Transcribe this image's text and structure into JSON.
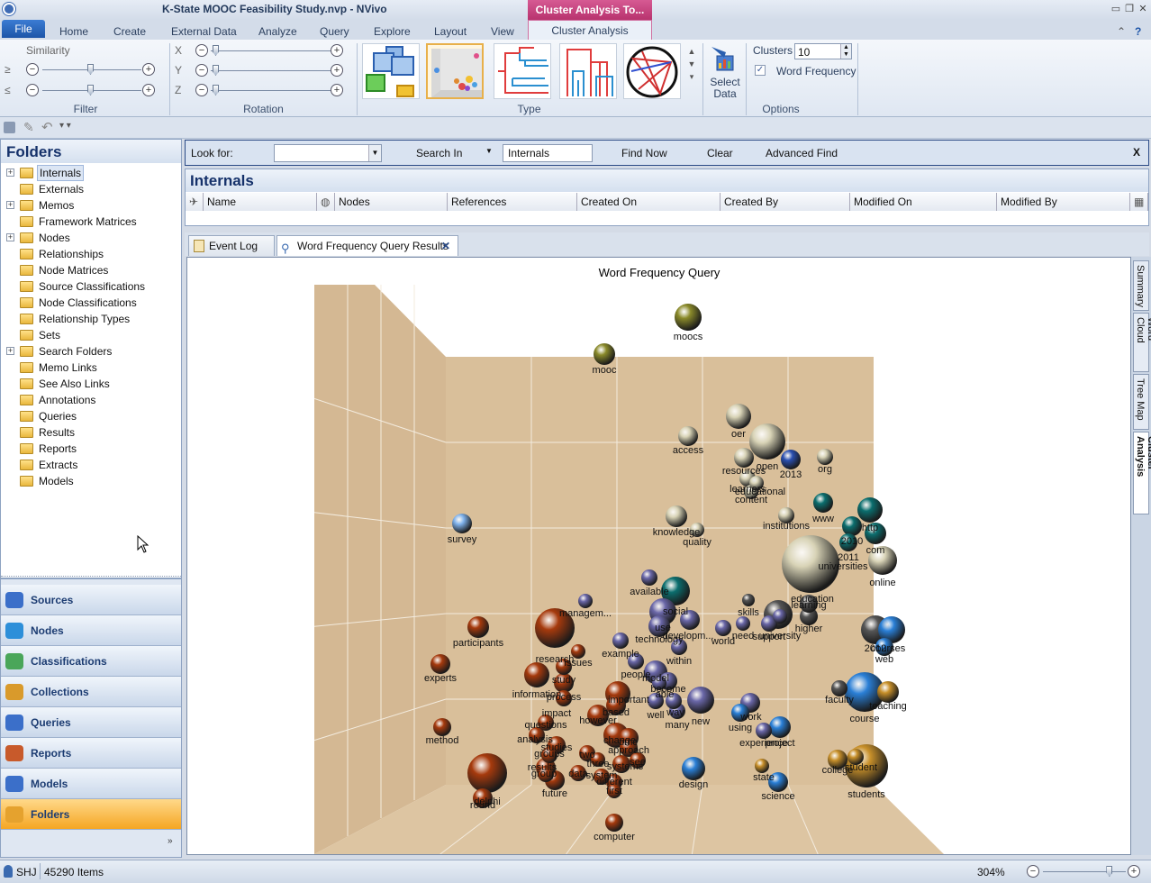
{
  "window": {
    "title": "K-State MOOC Feasibility Study.nvp - NVivo",
    "context_tab": "Cluster Analysis To..."
  },
  "ribbon_tabs": [
    "File",
    "Home",
    "Create",
    "External Data",
    "Analyze",
    "Query",
    "Explore",
    "Layout",
    "View",
    "Cluster Analysis"
  ],
  "ribbon": {
    "filter": {
      "group": "Filter",
      "label": "Similarity",
      "ge": "≥",
      "le": "≤",
      "ge_level": 0.5,
      "le_level": 0.5
    },
    "rotation": {
      "group": "Rotation",
      "x": "X",
      "y": "Y",
      "z": "Z",
      "x_level": 0.1,
      "y_level": 0.1,
      "z_level": 0.1
    },
    "type": {
      "group": "Type"
    },
    "select_data": {
      "label1": "Select",
      "label2": "Data"
    },
    "options": {
      "group": "Options",
      "clusters_label": "Clusters",
      "clusters_value": "10",
      "word_frequency": "Word Frequency",
      "word_frequency_checked": true
    }
  },
  "nav": {
    "folders_title": "Folders",
    "tree": [
      {
        "label": "Internals",
        "expand": true,
        "selected": true
      },
      {
        "label": "Externals",
        "expand": false
      },
      {
        "label": "Memos",
        "expand": true
      },
      {
        "label": "Framework Matrices",
        "expand": false
      },
      {
        "label": "Nodes",
        "expand": true
      },
      {
        "label": "Relationships",
        "expand": false
      },
      {
        "label": "Node Matrices",
        "expand": false
      },
      {
        "label": "Source Classifications",
        "expand": false
      },
      {
        "label": "Node Classifications",
        "expand": false
      },
      {
        "label": "Relationship Types",
        "expand": false
      },
      {
        "label": "Sets",
        "expand": false
      },
      {
        "label": "Search Folders",
        "expand": true
      },
      {
        "label": "Memo Links",
        "expand": false
      },
      {
        "label": "See Also Links",
        "expand": false
      },
      {
        "label": "Annotations",
        "expand": false
      },
      {
        "label": "Queries",
        "expand": false
      },
      {
        "label": "Results",
        "expand": false
      },
      {
        "label": "Reports",
        "expand": false
      },
      {
        "label": "Extracts",
        "expand": false
      },
      {
        "label": "Models",
        "expand": false
      }
    ],
    "buttons": [
      {
        "label": "Sources",
        "color": "#3b6fc9"
      },
      {
        "label": "Nodes",
        "color": "#2d8fd9"
      },
      {
        "label": "Classifications",
        "color": "#4aa65a"
      },
      {
        "label": "Collections",
        "color": "#d99a2b"
      },
      {
        "label": "Queries",
        "color": "#3b6fc9"
      },
      {
        "label": "Reports",
        "color": "#c85a2b"
      },
      {
        "label": "Models",
        "color": "#3b6fc9"
      },
      {
        "label": "Folders",
        "color": "#e5a22e",
        "active": true
      }
    ]
  },
  "find": {
    "look_for": "Look for:",
    "search_in": "Search In",
    "search_in_value": "Internals",
    "find_now": "Find Now",
    "clear": "Clear",
    "advanced": "Advanced Find",
    "close": "X"
  },
  "internals": {
    "title": "Internals",
    "columns": [
      "Name",
      "Nodes",
      "References",
      "Created On",
      "Created By",
      "Modified On",
      "Modified By"
    ]
  },
  "doc_tabs": [
    {
      "label": "Event Log"
    },
    {
      "label": "Word Frequency Query Results",
      "active": true
    }
  ],
  "side_tabs": [
    "Summary",
    "Word Cloud",
    "Tree Map",
    "Cluster Analysis"
  ],
  "chart_data": {
    "type": "scatter",
    "title": "Word Frequency Query",
    "clusters": 10,
    "points": [
      {
        "label": "moocs",
        "color": "#8a8a2a"
      },
      {
        "label": "mooc",
        "color": "#8a8a2a"
      },
      {
        "label": "oer",
        "color": "#d8d3b6"
      },
      {
        "label": "access",
        "color": "#d8d3b6"
      },
      {
        "label": "open",
        "color": "#d8d3b6"
      },
      {
        "label": "2013",
        "color": "#2a4fb0"
      },
      {
        "label": "org",
        "color": "#d8d3b6"
      },
      {
        "label": "resources",
        "color": "#d8d3b6"
      },
      {
        "label": "learners",
        "color": "#d8d3b6"
      },
      {
        "label": "educational",
        "color": "#d8d3b6"
      },
      {
        "label": "content",
        "color": "#d8d3b6"
      },
      {
        "label": "www",
        "color": "#0b6e6e"
      },
      {
        "label": "http",
        "color": "#0b6e6e"
      },
      {
        "label": "2010",
        "color": "#0b6e6e"
      },
      {
        "label": "com",
        "color": "#0b6e6e"
      },
      {
        "label": "2011",
        "color": "#0b6e6e"
      },
      {
        "label": "institutions",
        "color": "#d8d3b6"
      },
      {
        "label": "knowledge",
        "color": "#d8d3b6"
      },
      {
        "label": "quality",
        "color": "#d8d3b6"
      },
      {
        "label": "universities",
        "color": "#d8d3b6"
      },
      {
        "label": "online",
        "color": "#d8d3b6"
      },
      {
        "label": "survey",
        "color": "#7fb2ec"
      },
      {
        "label": "available",
        "color": "#6a67a8"
      },
      {
        "label": "social",
        "color": "#0b6e6e"
      },
      {
        "label": "managem...",
        "color": "#6a67a8"
      },
      {
        "label": "use",
        "color": "#6a67a8"
      },
      {
        "label": "developm...",
        "color": "#6a67a8"
      },
      {
        "label": "technology",
        "color": "#6a67a8"
      },
      {
        "label": "world",
        "color": "#6a67a8"
      },
      {
        "label": "need",
        "color": "#6a67a8"
      },
      {
        "label": "support",
        "color": "#6a67a8"
      },
      {
        "label": "university",
        "color": "#6a67a8"
      },
      {
        "label": "skills",
        "color": "#555555"
      },
      {
        "label": "education",
        "color": "#555555"
      },
      {
        "label": "learning",
        "color": "#555555"
      },
      {
        "label": "higher",
        "color": "#555555"
      },
      {
        "label": "participants",
        "color": "#a63a0d"
      },
      {
        "label": "experts",
        "color": "#a63a0d"
      },
      {
        "label": "research",
        "color": "#a63a0d"
      },
      {
        "label": "issues",
        "color": "#a63a0d"
      },
      {
        "label": "study",
        "color": "#a63a0d"
      },
      {
        "label": "example",
        "color": "#6a67a8"
      },
      {
        "label": "within",
        "color": "#6a67a8"
      },
      {
        "label": "people",
        "color": "#6a67a8"
      },
      {
        "label": "model",
        "color": "#6a67a8"
      },
      {
        "label": "become",
        "color": "#6a67a8"
      },
      {
        "label": "able",
        "color": "#6a67a8"
      },
      {
        "label": "information",
        "color": "#a63a0d"
      },
      {
        "label": "process",
        "color": "#a63a0d"
      },
      {
        "label": "impact",
        "color": "#a63a0d"
      },
      {
        "label": "important",
        "color": "#a63a0d"
      },
      {
        "label": "based",
        "color": "#a63a0d"
      },
      {
        "label": "however",
        "color": "#a63a0d"
      },
      {
        "label": "well",
        "color": "#6a67a8"
      },
      {
        "label": "way",
        "color": "#6a67a8"
      },
      {
        "label": "many",
        "color": "#6a67a8"
      },
      {
        "label": "new",
        "color": "#6a67a8"
      },
      {
        "label": "questions",
        "color": "#a63a0d"
      },
      {
        "label": "analysis",
        "color": "#a63a0d"
      },
      {
        "label": "change",
        "color": "#a63a0d"
      },
      {
        "label": "time",
        "color": "#a63a0d"
      },
      {
        "label": "approach",
        "color": "#a63a0d"
      },
      {
        "label": "studies",
        "color": "#a63a0d"
      },
      {
        "label": "groups",
        "color": "#a63a0d"
      },
      {
        "label": "two",
        "color": "#a63a0d"
      },
      {
        "label": "three",
        "color": "#a63a0d"
      },
      {
        "label": "systems",
        "color": "#a63a0d"
      },
      {
        "label": "see",
        "color": "#a63a0d"
      },
      {
        "label": "results",
        "color": "#a63a0d"
      },
      {
        "label": "group",
        "color": "#a63a0d"
      },
      {
        "label": "data",
        "color": "#a63a0d"
      },
      {
        "label": "system",
        "color": "#a63a0d"
      },
      {
        "label": "different",
        "color": "#a63a0d"
      },
      {
        "label": "first",
        "color": "#a63a0d"
      },
      {
        "label": "future",
        "color": "#a63a0d"
      },
      {
        "label": "method",
        "color": "#a63a0d"
      },
      {
        "label": "delphi",
        "color": "#a63a0d"
      },
      {
        "label": "round",
        "color": "#a63a0d"
      },
      {
        "label": "computer",
        "color": "#a63a0d"
      },
      {
        "label": "work",
        "color": "#6a67a8"
      },
      {
        "label": "using",
        "color": "#2a7fd6"
      },
      {
        "label": "experience",
        "color": "#6a67a8"
      },
      {
        "label": "project",
        "color": "#2a7fd6"
      },
      {
        "label": "design",
        "color": "#2a7fd6"
      },
      {
        "label": "state",
        "color": "#c8902a"
      },
      {
        "label": "science",
        "color": "#2a7fd6"
      },
      {
        "label": "courses",
        "color": "#2a7fd6"
      },
      {
        "label": "2012",
        "color": "#555555"
      },
      {
        "label": "web",
        "color": "#2a7fd6"
      },
      {
        "label": "faculty",
        "color": "#555555"
      },
      {
        "label": "teaching",
        "color": "#c8902a"
      },
      {
        "label": "course",
        "color": "#2a7fd6"
      },
      {
        "label": "college",
        "color": "#c8902a"
      },
      {
        "label": "student",
        "color": "#c8902a"
      },
      {
        "label": "students",
        "color": "#c8902a"
      }
    ]
  },
  "status": {
    "user": "SHJ",
    "items": "45290 Items",
    "zoom": "304%",
    "zoom_level": 0.8
  }
}
